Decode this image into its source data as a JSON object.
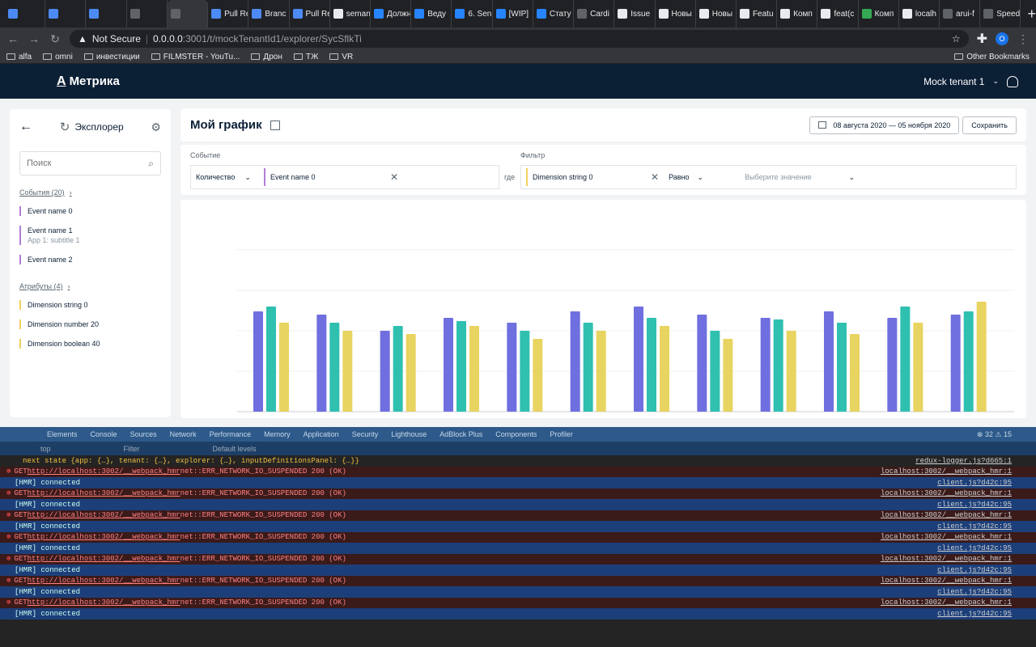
{
  "browser": {
    "tabs": [
      {
        "label": "",
        "color": "#4c8bf5"
      },
      {
        "label": "",
        "color": "#4c8bf5"
      },
      {
        "label": "",
        "color": "#4c8bf5"
      },
      {
        "label": "",
        "color": "#5f6368"
      },
      {
        "label": "",
        "color": "#5f6368"
      },
      {
        "label": "Pull Re",
        "color": "#4c8bf5"
      },
      {
        "label": "Branc",
        "color": "#4c8bf5"
      },
      {
        "label": "Pull Re",
        "color": "#4c8bf5"
      },
      {
        "label": "seman",
        "color": "#e8eaed"
      },
      {
        "label": "Должн",
        "color": "#2684ff"
      },
      {
        "label": "Веду",
        "color": "#2684ff"
      },
      {
        "label": "6. Sen",
        "color": "#2684ff"
      },
      {
        "label": "[WIP]",
        "color": "#2684ff"
      },
      {
        "label": "Стату",
        "color": "#2684ff"
      },
      {
        "label": "Cardi",
        "color": "#5f6368"
      },
      {
        "label": "Issue",
        "color": "#e8eaed"
      },
      {
        "label": "Новы",
        "color": "#e8eaed"
      },
      {
        "label": "Новы",
        "color": "#e8eaed"
      },
      {
        "label": "Featu",
        "color": "#e8eaed"
      },
      {
        "label": "Комп",
        "color": "#e8eaed"
      },
      {
        "label": "feat(c",
        "color": "#e8eaed"
      },
      {
        "label": "Комп",
        "color": "#34a853"
      },
      {
        "label": "localh",
        "color": "#e8eaed"
      },
      {
        "label": "arui-f",
        "color": "#5f6368"
      },
      {
        "label": "Speed",
        "color": "#5f6368"
      }
    ],
    "active_tab_index": 4,
    "new_tab": "+",
    "not_secure": "Not Secure",
    "url_host": "0.0.0.0",
    "url_rest": ":3001/t/mockTenantId1/explorer/SycSflkTi",
    "profile_letter": "O",
    "bookmarks": [
      "alfa",
      "omni",
      "инвестиции",
      "FILMSTER - YouTu...",
      "Дрон",
      "ТЖ",
      "VR"
    ],
    "other_bookmarks": "Other Bookmarks"
  },
  "header": {
    "logo_letter": "А",
    "logo_text": "Метрика",
    "tenant": "Mock tenant 1"
  },
  "sidebar": {
    "title": "Эксплорер",
    "search_placeholder": "Поиск",
    "events_link": "События (20)",
    "events": [
      {
        "name": "Event name 0",
        "sub": ""
      },
      {
        "name": "Event name 1",
        "sub": "App 1: subtitle 1"
      },
      {
        "name": "Event name 2",
        "sub": ""
      }
    ],
    "attrs_link": "Атрибуты (4)",
    "attrs": [
      "Dimension string 0",
      "Dimension number 20",
      "Dimension boolean 40"
    ]
  },
  "chart_header": {
    "title": "Мой график",
    "date_range": "08 августа 2020 — 05 ноября 2020",
    "save_label": "Сохранить"
  },
  "filters": {
    "event_label": "Событие",
    "filter_label": "Фильтр",
    "aggregation": "Количество",
    "event_value": "Event name 0",
    "where": "где",
    "dimension": "Dimension string 0",
    "operator": "Равно",
    "value_placeholder": "Выберите значение"
  },
  "chart_data": {
    "type": "bar",
    "title": "",
    "xlabel": "",
    "ylabel": "",
    "series": [
      {
        "name": "",
        "color": "#6f6fe0",
        "values": [
          0.62,
          0.6,
          0.5,
          0.58,
          0.55,
          0.62,
          0.65,
          0.6,
          0.58,
          0.62,
          0.58,
          0.6
        ]
      },
      {
        "name": "",
        "color": "#2fc0b0",
        "values": [
          0.65,
          0.55,
          0.53,
          0.56,
          0.5,
          0.55,
          0.58,
          0.5,
          0.57,
          0.55,
          0.65,
          0.62
        ]
      },
      {
        "name": "",
        "color": "#e8d460",
        "values": [
          0.55,
          0.5,
          0.48,
          0.53,
          0.45,
          0.5,
          0.53,
          0.45,
          0.5,
          0.48,
          0.55,
          0.68
        ]
      }
    ]
  },
  "devtools": {
    "tabs": [
      "Elements",
      "Console",
      "Sources",
      "Network",
      "Performance",
      "Memory",
      "Application",
      "Security",
      "Lighthouse",
      "AdBlock Plus",
      "Components",
      "Profiler"
    ],
    "counts": "⊗ 32  ⚠ 15",
    "bar_items": [
      "top",
      "Filter",
      "Default levels"
    ],
    "state_line": "next state  {app: {…}, tenant: {…}, explorer: {…}, inputDefinitionsPanel: {…}}",
    "state_src": "redux-logger.js?d665:1",
    "err_pre": "GET ",
    "err_url": "http://localhost:3002/__webpack_hmr",
    "err_msg": " net::ERR_NETWORK_IO_SUSPENDED 200 (OK)",
    "err_src": "localhost:3002/__webpack_hmr:1",
    "info_msg": "[HMR] connected",
    "info_src": "client.js?d42c:95"
  }
}
